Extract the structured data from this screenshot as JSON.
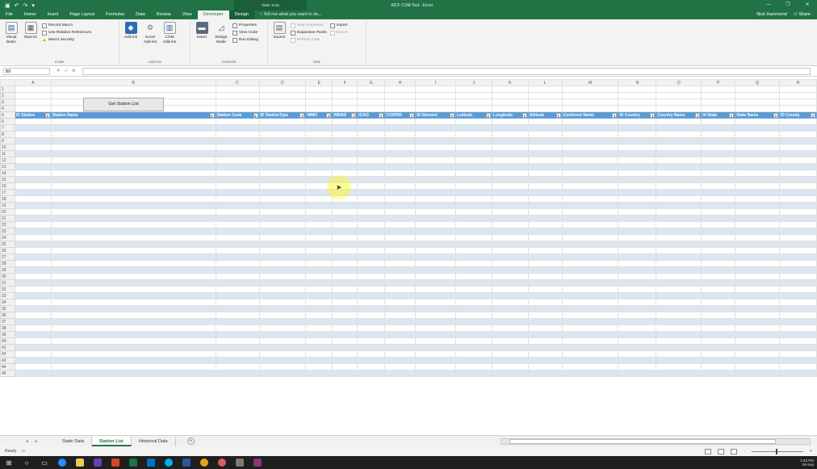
{
  "window": {
    "title": "WCF COM Test - Excel",
    "context_group": "Table Tools",
    "controls": [
      "—",
      "❐",
      "✕"
    ]
  },
  "tabs": [
    {
      "label": "File"
    },
    {
      "label": "Home"
    },
    {
      "label": "Insert"
    },
    {
      "label": "Page Layout"
    },
    {
      "label": "Formulas"
    },
    {
      "label": "Data"
    },
    {
      "label": "Review"
    },
    {
      "label": "View"
    },
    {
      "label": "Developer",
      "active": true
    },
    {
      "label": "Design",
      "context": true
    }
  ],
  "tellme": "Tell me what you want to do...",
  "account": {
    "user": "Nick Hammond",
    "share": "Share"
  },
  "ribbon": {
    "code": {
      "label": "Code",
      "visual_basic": "Visual Basic",
      "macros": "Macros",
      "record_macro": "Record Macro",
      "relative_refs": "Use Relative References",
      "macro_security": "Macro Security"
    },
    "addins": {
      "label": "Add-ins",
      "addins": "Add-ins",
      "excel_addins": "Excel Add-ins",
      "com_addins": "COM Add-ins"
    },
    "controls": {
      "label": "Controls",
      "insert": "Insert",
      "design_mode": "Design Mode",
      "properties": "Properties",
      "view_code": "View Code",
      "run_dialog": "Run Dialog"
    },
    "xml": {
      "label": "XML",
      "source": "Source",
      "map_properties": "Map Properties",
      "expansion_packs": "Expansion Packs",
      "refresh_data": "Refresh Data",
      "import": "Import",
      "export": "Export"
    }
  },
  "formula_bar": {
    "name_box": "B8",
    "fx": "fx"
  },
  "sheet": {
    "columns": [
      "A",
      "B",
      "C",
      "D",
      "E",
      "F",
      "G",
      "H",
      "I",
      "J",
      "K",
      "L",
      "M",
      "N",
      "O",
      "P",
      "Q",
      "R"
    ],
    "header_row": 5,
    "headers": [
      "ID Station",
      "Station Name",
      "Station Code",
      "ID StationType",
      "WMO",
      "WBAN",
      "ICAO",
      "COOPID",
      "ID Element",
      "Latitude",
      "Longitude",
      "Altitude",
      "Continent Name",
      "ID Country",
      "Country Name",
      "Id State",
      "State Name",
      "ID County"
    ],
    "button_label": "Get Station List",
    "row_count": 45
  },
  "sheet_tabs": [
    {
      "label": "Static Data"
    },
    {
      "label": "Station List",
      "active": true
    },
    {
      "label": "Historical Data"
    }
  ],
  "status": {
    "text": "Ready",
    "zoom_minus": "-",
    "zoom_plus": "+"
  },
  "clock": {
    "time": "3:43 PM",
    "date": "26-Sep"
  }
}
